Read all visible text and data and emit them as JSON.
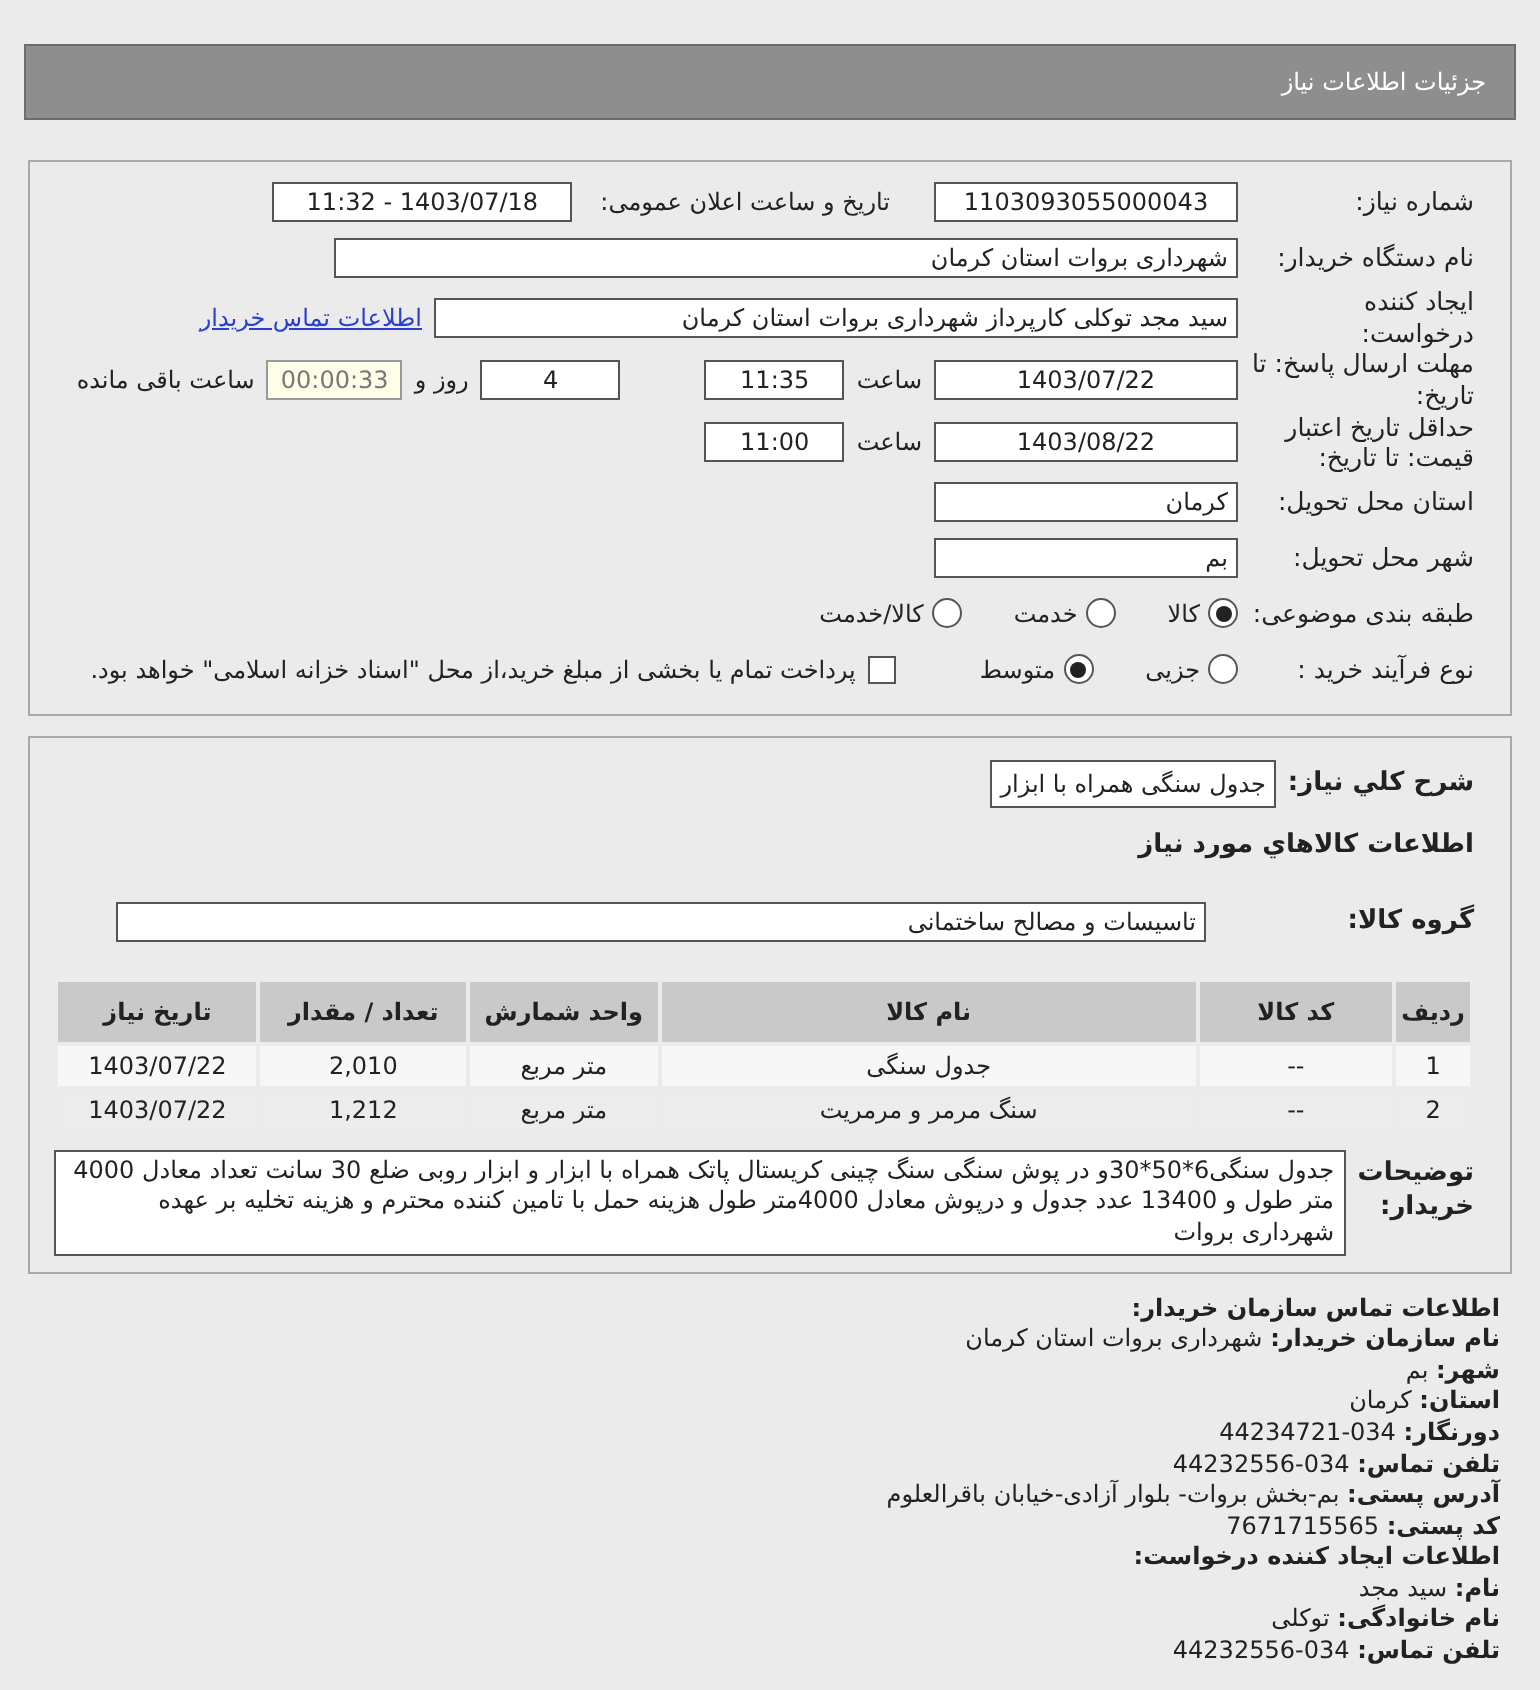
{
  "header": {
    "title": "جزئیات اطلاعات نیاز"
  },
  "details": {
    "need_number": {
      "label": "شماره نیاز:",
      "value": "1103093055000043"
    },
    "announce": {
      "label": "تاریخ و ساعت اعلان عمومی:",
      "value": "1403/07/18 - 11:32"
    },
    "buyer": {
      "label": "نام دستگاه خریدار:",
      "value": "شهرداری بروات استان کرمان"
    },
    "requester": {
      "label": "ایجاد کننده درخواست:",
      "value": "سید مجد توکلی کارپرداز شهرداری بروات استان کرمان",
      "link": "اطلاعات تماس خریدار"
    },
    "deadline": {
      "label": "مهلت ارسال پاسخ: تا تاریخ:",
      "date": "1403/07/22",
      "time_label": "ساعت",
      "time": "11:35",
      "days": "4",
      "days_label": "روز و",
      "remaining": "00:00:33",
      "remaining_label": "ساعت باقی مانده"
    },
    "validity": {
      "label": "حداقل تاریخ اعتبار قیمت: تا تاریخ:",
      "date": "1403/08/22",
      "time_label": "ساعت",
      "time": "11:00"
    },
    "province": {
      "label": "استان محل تحویل:",
      "value": "کرمان"
    },
    "city": {
      "label": "شهر محل تحویل:",
      "value": "بم"
    },
    "category": {
      "label": "طبقه بندی موضوعی:",
      "options": [
        {
          "label": "کالا",
          "selected": true
        },
        {
          "label": "خدمت",
          "selected": false
        },
        {
          "label": "کالا/خدمت",
          "selected": false
        }
      ]
    },
    "process": {
      "label": "نوع فرآیند خرید :",
      "options": [
        {
          "label": "جزیی",
          "selected": false
        },
        {
          "label": "متوسط",
          "selected": true
        }
      ],
      "payment": {
        "checked": false,
        "text": "پرداخت تمام یا بخشی از مبلغ خرید،از محل \"اسناد خزانه اسلامی\" خواهد بود."
      }
    }
  },
  "goods": {
    "summary_label": "شرح کلي نياز:",
    "summary": "جدول سنگی همراه با ابزار",
    "section_title": "اطلاعات کالاهاي مورد نياز",
    "group_label": "گروه کالا:",
    "group": "تاسیسات و مصالح ساختمانی",
    "table": {
      "columns": [
        "ردیف",
        "کد کالا",
        "نام کالا",
        "واحد شمارش",
        "تعداد / مقدار",
        "تاریخ نیاز"
      ],
      "rows": [
        [
          "1",
          "--",
          "جدول سنگی",
          "متر مربع",
          "2,010",
          "1403/07/22"
        ],
        [
          "2",
          "--",
          "سنگ مرمر و مرمریت",
          "متر مربع",
          "1,212",
          "1403/07/22"
        ]
      ]
    },
    "description_label": "توضیحات خریدار:",
    "description": "جدول سنگی6*50*30و در پوش سنگی سنگ چینی کریستال پاتک همراه با ابزار و ابزار روبی ضلع 30 سانت تعداد معادل 4000 متر طول و 13400 عدد جدول و درپوش معادل 4000متر طول هزینه حمل با تامین کننده محترم و هزینه تخلیه بر عهده شهرداری بروات"
  },
  "contact": [
    {
      "kind": "heading",
      "text": "اطلاعات تماس سازمان خریدار:"
    },
    {
      "kind": "field",
      "text": "**نام سازمان خریدار:** شهرداری بروات استان کرمان"
    },
    {
      "kind": "field",
      "text": "**شهر:** بم"
    },
    {
      "kind": "field",
      "text": "**استان:** کرمان"
    },
    {
      "kind": "field",
      "text": "**دورنگار:** 034-44234721"
    },
    {
      "kind": "field",
      "text": "**تلفن تماس:** 034-44232556"
    },
    {
      "kind": "field",
      "text": "**آدرس پستی:** بم-بخش بروات- بلوار آزادی-خیابان باقرالعلوم"
    },
    {
      "kind": "field",
      "text": "**کد پستی:** 7671715565"
    },
    {
      "kind": "heading",
      "text": "اطلاعات ایجاد کننده درخواست:"
    },
    {
      "kind": "field",
      "text": "**نام:** سید مجد"
    },
    {
      "kind": "field",
      "text": "**نام خانوادگی:** توکلی"
    },
    {
      "kind": "field",
      "text": "**تلفن تماس:** 034-44232556"
    }
  ]
}
